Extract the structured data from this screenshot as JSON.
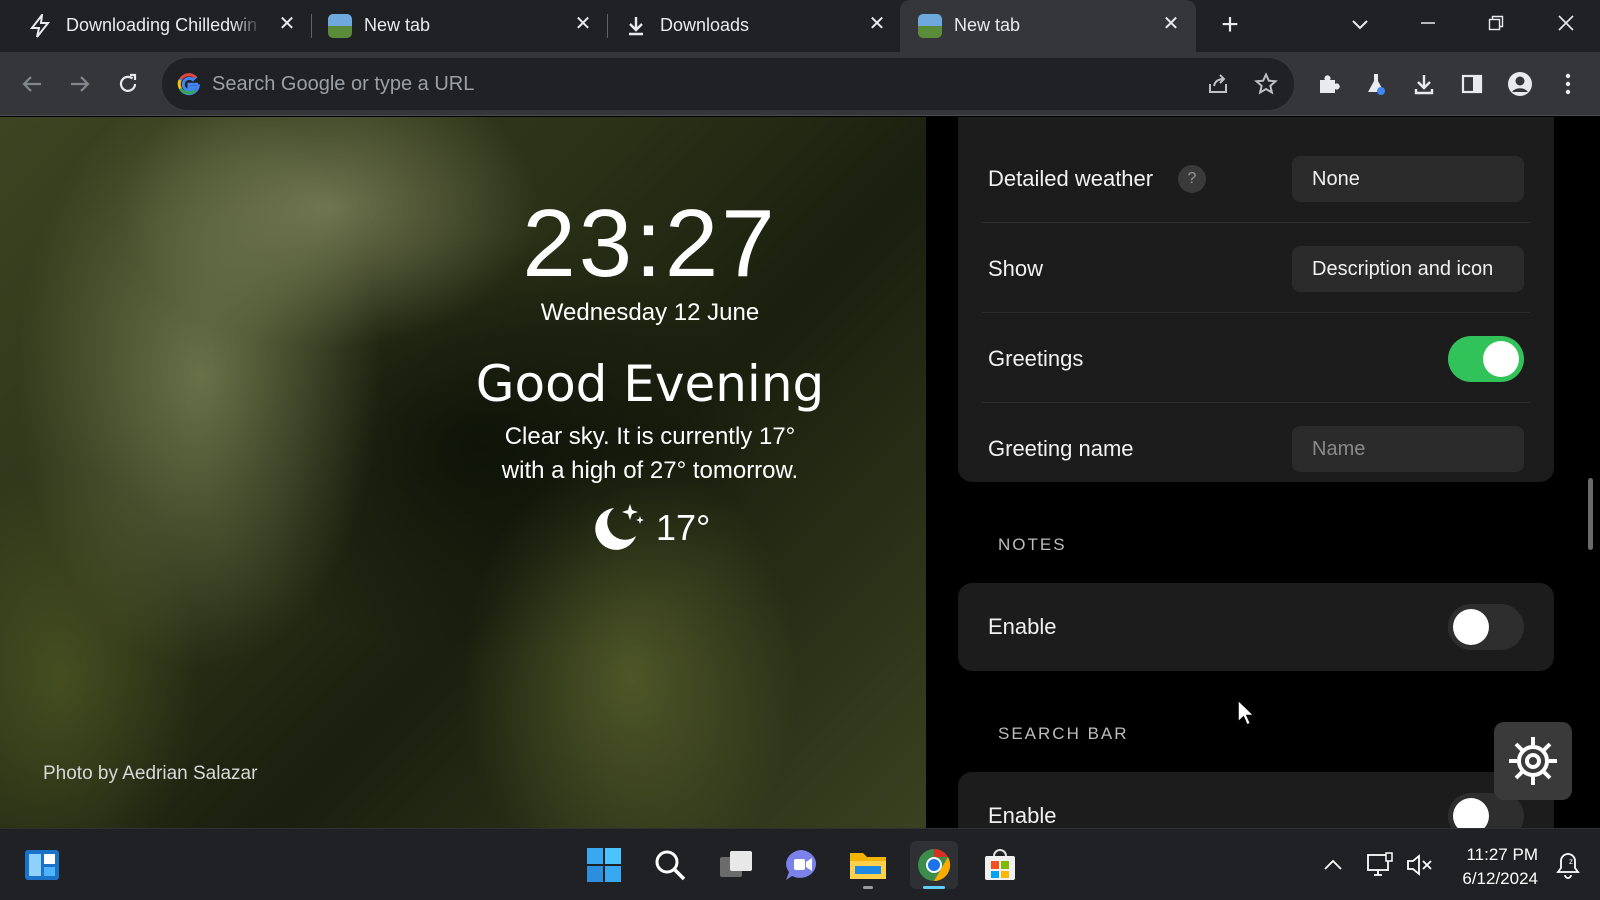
{
  "browser": {
    "tabs": [
      {
        "title": "Downloading Chilledwin",
        "favicon": "lightning-icon",
        "active": false
      },
      {
        "title": "New tab",
        "favicon": "landscape-icon",
        "active": false
      },
      {
        "title": "Downloads",
        "favicon": "download-icon",
        "active": false
      },
      {
        "title": "New tab",
        "favicon": "landscape-icon",
        "active": true
      }
    ],
    "new_tab_label": "+",
    "omnibox_placeholder": "Search Google or type a URL"
  },
  "newtab": {
    "time": "23:27",
    "date": "Wednesday 12 June",
    "greeting": "Good Evening",
    "weather_line1": "Clear sky. It is currently 17°",
    "weather_line2": "with a high of 27° tomorrow.",
    "weather_icon": "moon-stars-icon",
    "temperature": "17°",
    "photo_credit": "Photo by Aedrian Salazar"
  },
  "settings": {
    "detailed_weather_label": "Detailed weather",
    "help_label": "?",
    "detailed_weather_value": "None",
    "show_label": "Show",
    "show_value": "Description and icon",
    "greetings_label": "Greetings",
    "greetings_enabled": true,
    "greeting_name_label": "Greeting name",
    "greeting_name_placeholder": "Name",
    "notes_section": "NOTES",
    "notes_enable_label": "Enable",
    "notes_enabled": false,
    "search_section": "SEARCH BAR",
    "search_enable_label": "Enable",
    "search_enabled": false
  },
  "taskbar": {
    "time": "11:27 PM",
    "date": "6/12/2024",
    "apps": [
      "widgets-icon",
      "start-icon",
      "search-icon",
      "task-view-icon",
      "teams-chat-icon",
      "file-explorer-icon",
      "chrome-icon",
      "store-icon"
    ]
  },
  "colors": {
    "toggle_on": "#32c25a",
    "accent": "#60cdff"
  }
}
